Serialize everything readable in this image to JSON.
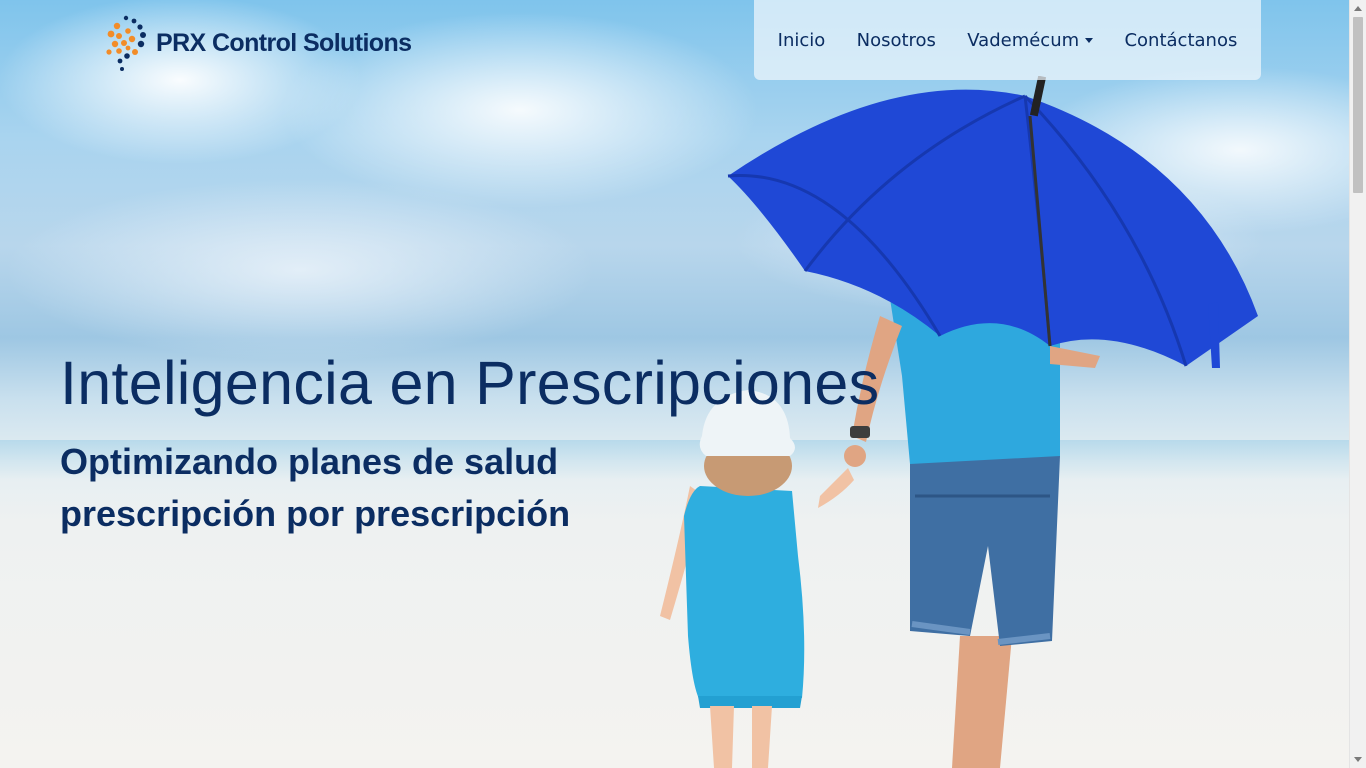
{
  "brand": {
    "name": "PRX Control Solutions",
    "logo_icon": "dotted-spiral-logo-icon"
  },
  "nav": {
    "items": [
      {
        "label": "Inicio"
      },
      {
        "label": "Nosotros"
      },
      {
        "label": "Vademécum",
        "has_dropdown": true
      },
      {
        "label": "Contáctanos"
      }
    ]
  },
  "hero": {
    "title": "Inteligencia en Prescripciones",
    "subtitle_line1": "Optimizando planes de salud",
    "subtitle_line2": "prescripción por prescripción",
    "image": "beach-parent-child-umbrella-image"
  },
  "colors": {
    "text_primary": "#0b2d62",
    "logo_orange": "#f28c28",
    "umbrella_blue": "#1f48d6",
    "dress_cyan": "#29a9dc"
  }
}
